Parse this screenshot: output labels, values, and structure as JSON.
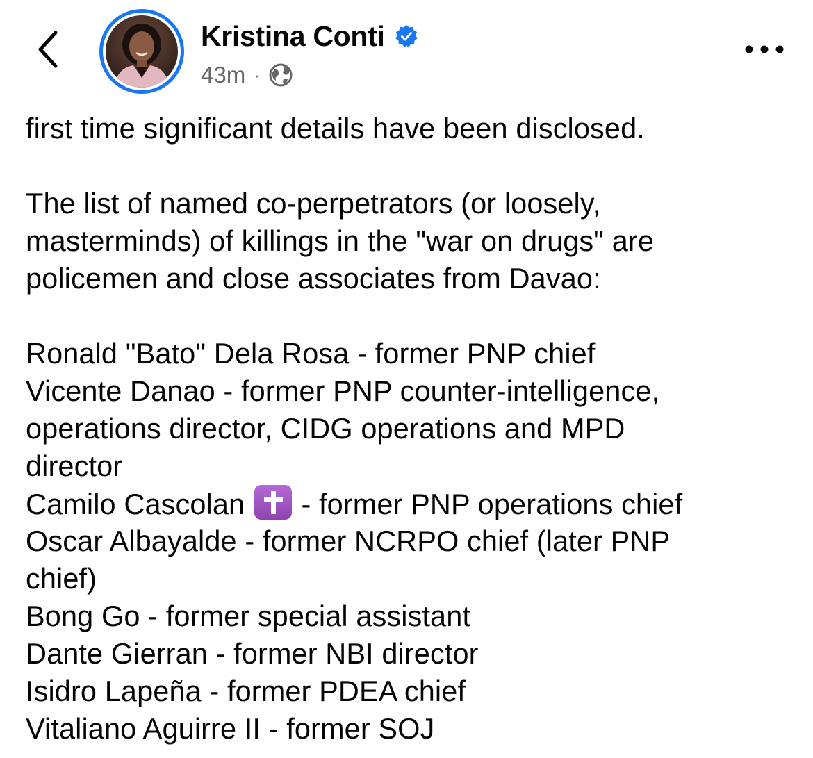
{
  "header": {
    "author_name": "Kristina Conti",
    "timestamp": "43m",
    "separator": "·",
    "privacy_icon": "globe-icon",
    "verified_icon": "verified-badge-icon",
    "back_icon": "chevron-left-icon",
    "more_icon": "more-horizontal-icon",
    "accent_color": "#1877f2"
  },
  "post": {
    "lines": [
      "first time significant details have been disclosed.",
      "",
      "The list of named co-perpetrators (or loosely,",
      "masterminds) of killings in the \"war on drugs\" are",
      "policemen and close associates from Davao:",
      "",
      "Ronald \"Bato\" Dela Rosa - former PNP chief",
      "Vicente Danao - former PNP counter-intelligence,",
      "operations director, CIDG operations and MPD",
      "director"
    ],
    "cascolan_name": "Camilo Cascolan",
    "cascolan_emoji": "latin-cross-emoji",
    "cascolan_role": " - former PNP operations chief",
    "lines_after": [
      "Oscar Albayalde - former NCRPO chief (later PNP",
      "chief)",
      "Bong Go - former special assistant",
      "Dante Gierran - former NBI director",
      "Isidro Lapeña - former PDEA chief",
      "Vitaliano Aguirre II - former SOJ"
    ]
  }
}
